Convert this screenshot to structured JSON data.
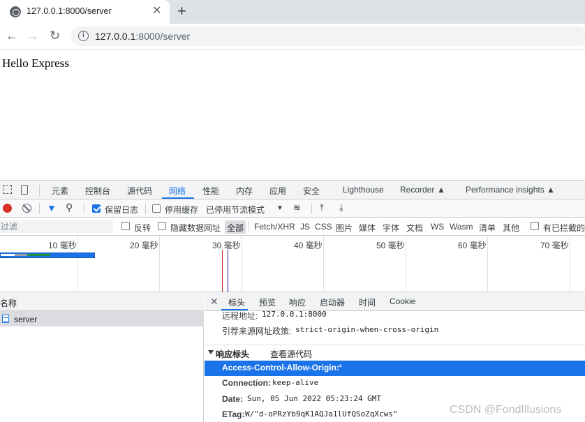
{
  "browser": {
    "tab_title": "127.0.0.1:8000/server",
    "url_host": "127.0.0.1",
    "url_rest": ":8000/server"
  },
  "page": {
    "body_text": "Hello Express"
  },
  "devtools": {
    "tabs": [
      "元素",
      "控制台",
      "源代码",
      "网络",
      "性能",
      "内存",
      "应用",
      "安全",
      "Lighthouse",
      "Recorder",
      "Performance insights"
    ],
    "active_tab": "网络",
    "toolbar": {
      "preserve_log": "保留日志",
      "disable_cache": "停用缓存",
      "throttling": "已停用节流模式"
    },
    "filter": {
      "placeholder": "过滤",
      "invert": "反转",
      "hide_data_urls": "隐藏数据网址",
      "types": [
        "全部",
        "Fetch/XHR",
        "JS",
        "CSS",
        "图片",
        "媒体",
        "字体",
        "文档",
        "WS",
        "Wasm",
        "清单",
        "其他"
      ],
      "blocked": "有已拦截的"
    },
    "timeline": {
      "labels": [
        "10 毫秒",
        "20 毫秒",
        "30 毫秒",
        "40 毫秒",
        "50 毫秒",
        "60 毫秒",
        "70 毫秒"
      ],
      "colors": {
        "domcontent": "#1a1aa6",
        "load": "#c5221f",
        "waiting": "#1e8e3e",
        "download": "#1a73e8"
      }
    },
    "requests": {
      "header": "名称",
      "rows": [
        "server"
      ]
    },
    "detail": {
      "tabs": [
        "标头",
        "预览",
        "响应",
        "启动器",
        "时间",
        "Cookie"
      ],
      "active_tab": "标头",
      "general": [
        {
          "k": "远程地址:",
          "v": "127.0.0.1:8000"
        },
        {
          "k": "引荐来源网址政策:",
          "v": "strict-origin-when-cross-origin"
        }
      ],
      "response_headers_label": "响应标头",
      "view_source": "查看源代码",
      "response_headers": [
        {
          "k": "Access-Control-Allow-Origin:",
          "v": "*"
        },
        {
          "k": "Connection:",
          "v": "keep-alive"
        },
        {
          "k": "Date:",
          "v": "Sun, 05 Jun 2022 05:23:24 GMT"
        },
        {
          "k": "ETag:",
          "v": "W/\"d-oPRzYb9qK1AQJa1lUfQSoZqXcws\""
        }
      ]
    }
  },
  "watermark": "CSDN @FondIllusions"
}
